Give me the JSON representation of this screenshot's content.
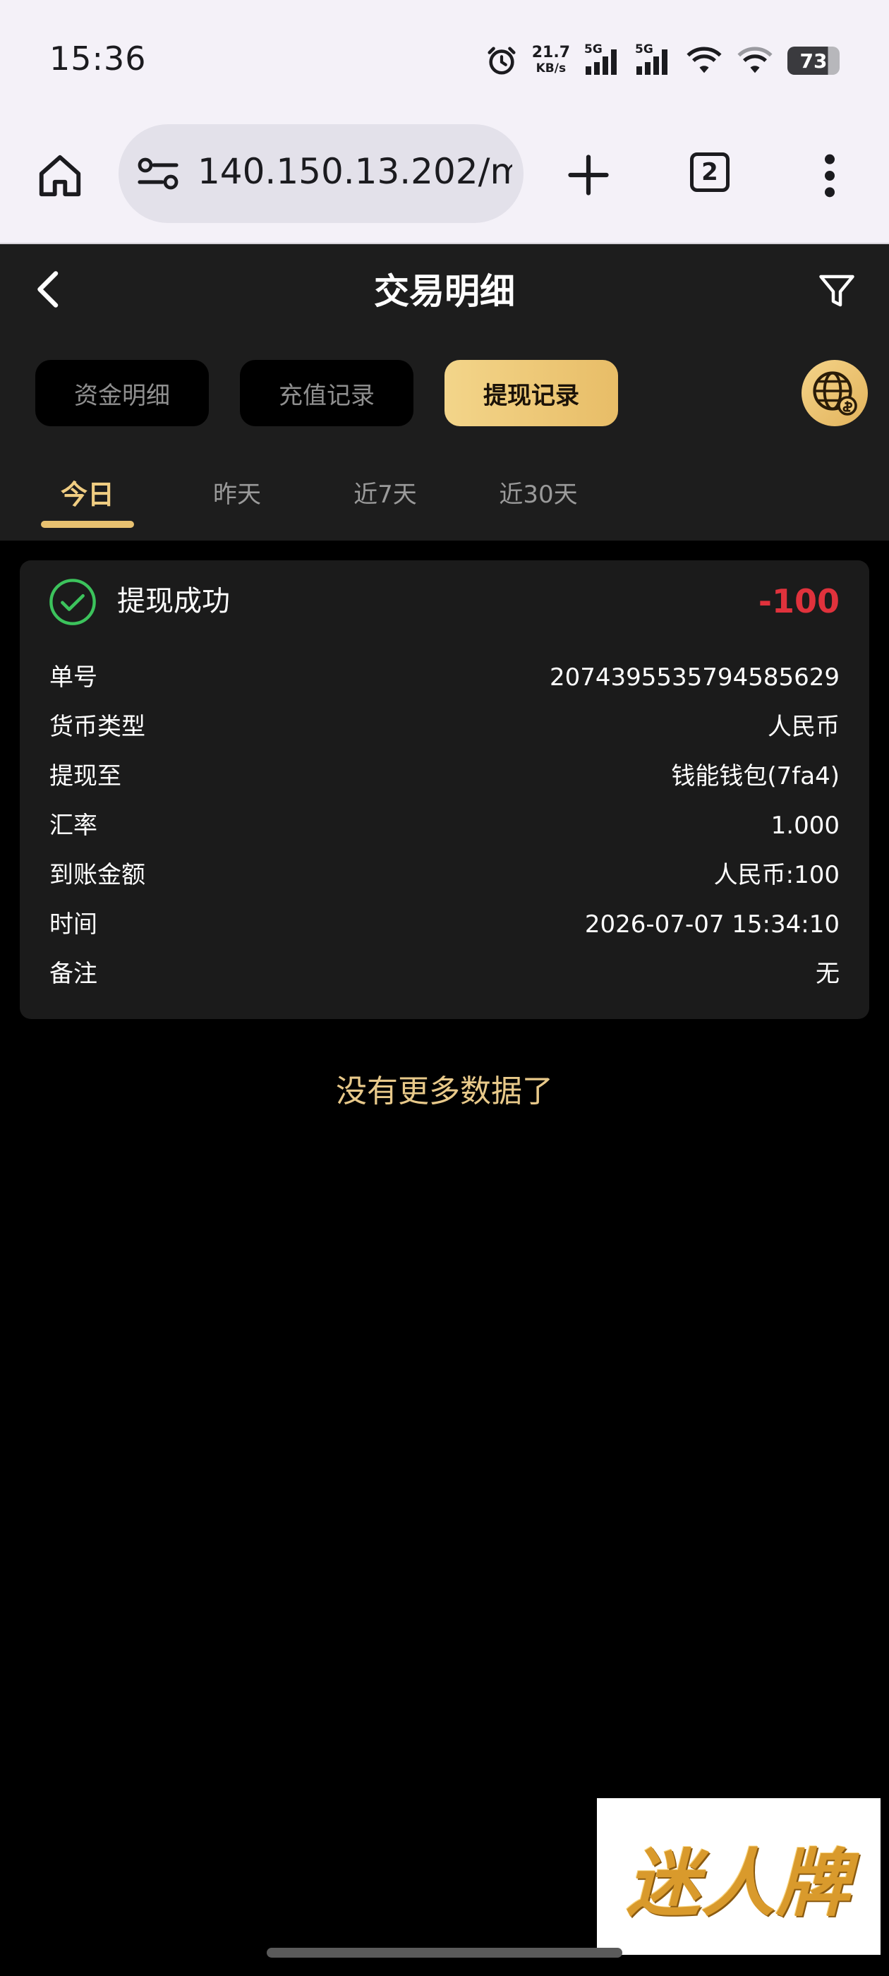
{
  "status_bar": {
    "time": "15:36",
    "net_speed_value": "21.7",
    "net_speed_unit": "KB/s",
    "signal_1_tag": "5G",
    "signal_2_tag": "5G",
    "battery": "73",
    "icons": [
      "alarm-icon",
      "signal-icon",
      "signal-icon",
      "wifi-icon",
      "wifi-icon",
      "battery-icon"
    ]
  },
  "browser": {
    "url": "140.150.13.202/m",
    "tab_count": "2",
    "icons": [
      "home-icon",
      "site-settings-icon",
      "plus-icon",
      "more-icon"
    ]
  },
  "header": {
    "title": "交易明细",
    "icons": [
      "back-icon",
      "filter-icon",
      "globe-icon"
    ]
  },
  "segments": [
    {
      "label": "资金明细",
      "active": false
    },
    {
      "label": "充值记录",
      "active": false
    },
    {
      "label": "提现记录",
      "active": true
    }
  ],
  "day_tabs": [
    {
      "label": "今日",
      "active": true
    },
    {
      "label": "昨天",
      "active": false
    },
    {
      "label": "近7天",
      "active": false
    },
    {
      "label": "近30天",
      "active": false
    }
  ],
  "record": {
    "status": "提现成功",
    "amount": "-100",
    "rows": [
      {
        "label": "单号",
        "value": "2074395535794585629"
      },
      {
        "label": "货币类型",
        "value": "人民币"
      },
      {
        "label": "提现至",
        "value": "钱能钱包(7fa4)"
      },
      {
        "label": "汇率",
        "value": "1.000"
      },
      {
        "label": "到账金额",
        "value": "人民币:100"
      },
      {
        "label": "时间",
        "value": "2026-07-07 15:34:10"
      },
      {
        "label": "备注",
        "value": "无"
      }
    ]
  },
  "no_more_text": "没有更多数据了",
  "watermark": "迷人牌",
  "colors": {
    "accent_gold": "#e8bd67",
    "negative_red": "#e0323c",
    "success_green": "#3cc35c"
  }
}
